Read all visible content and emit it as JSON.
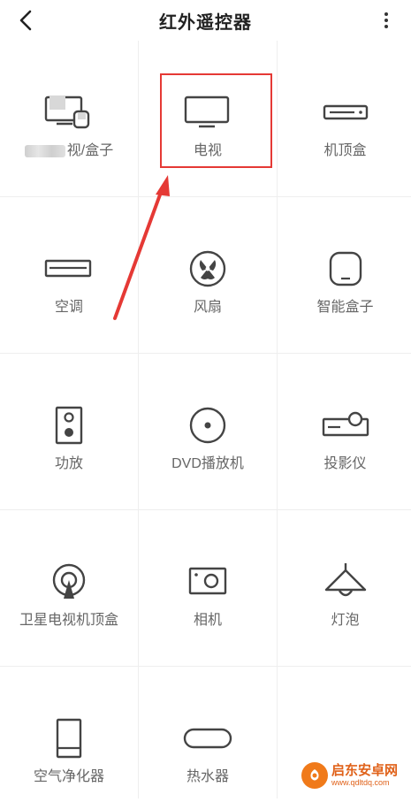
{
  "header": {
    "title": "红外遥控器",
    "back_icon": "chevron-left-icon",
    "more_icon": "more-vertical-icon"
  },
  "devices": [
    {
      "label": "视/盒子",
      "icon": "tv-box-icon",
      "blurred_prefix": true
    },
    {
      "label": "电视",
      "icon": "tv-icon"
    },
    {
      "label": "机顶盒",
      "icon": "set-top-box-icon"
    },
    {
      "label": "空调",
      "icon": "air-conditioner-icon"
    },
    {
      "label": "风扇",
      "icon": "fan-icon"
    },
    {
      "label": "智能盒子",
      "icon": "smart-box-icon"
    },
    {
      "label": "功放",
      "icon": "amplifier-icon"
    },
    {
      "label": "DVD播放机",
      "icon": "dvd-player-icon"
    },
    {
      "label": "投影仪",
      "icon": "projector-icon"
    },
    {
      "label": "卫星电视机顶盒",
      "icon": "satellite-icon"
    },
    {
      "label": "相机",
      "icon": "camera-icon"
    },
    {
      "label": "灯泡",
      "icon": "lamp-icon"
    },
    {
      "label": "空气净化器",
      "icon": "air-purifier-icon"
    },
    {
      "label": "热水器",
      "icon": "water-heater-icon"
    }
  ],
  "annotation": {
    "highlight_color": "#e53935",
    "highlighted_item": "电视"
  },
  "watermark": {
    "text": "启东安卓网",
    "url": "www.qdltdq.com"
  }
}
